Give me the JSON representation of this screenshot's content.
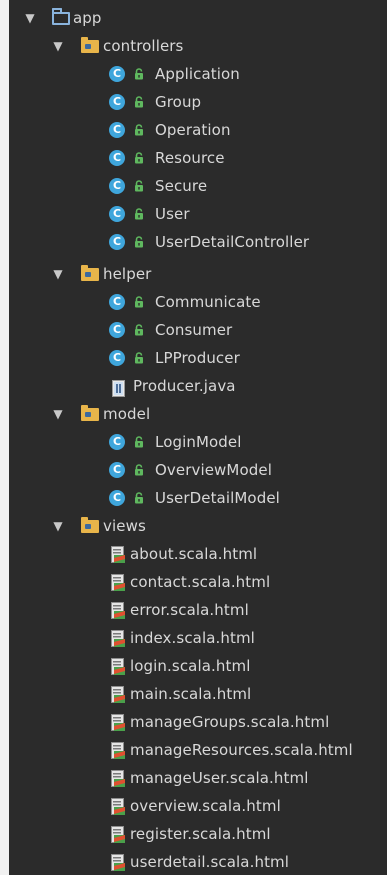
{
  "tree": {
    "root": {
      "label": "app",
      "icon": "folder-icon"
    },
    "controllers": {
      "label": "controllers",
      "items": [
        "Application",
        "Group",
        "Operation",
        "Resource",
        "Secure",
        "User",
        "UserDetailController"
      ]
    },
    "helper": {
      "label": "helper",
      "classes": [
        "Communicate",
        "Consumer",
        "LPProducer"
      ],
      "file": "Producer.java"
    },
    "model": {
      "label": "model",
      "items": [
        "LoginModel",
        "OverviewModel",
        "UserDetailModel"
      ]
    },
    "views": {
      "label": "views",
      "items": [
        "about.scala.html",
        "contact.scala.html",
        "error.scala.html",
        "index.scala.html",
        "login.scala.html",
        "main.scala.html",
        "manageGroups.scala.html",
        "manageResources.scala.html",
        "manageUser.scala.html",
        "overview.scala.html",
        "register.scala.html",
        "userdetail.scala.html"
      ]
    }
  },
  "glyphs": {
    "expanded_arrow": "▼",
    "class_letter": "C"
  },
  "colors": {
    "background": "#2b2b2b",
    "text": "#d8d8d8",
    "package_folder": "#e8b54a",
    "class_badge": "#3fa6dc",
    "lock": "#5fb85f"
  }
}
